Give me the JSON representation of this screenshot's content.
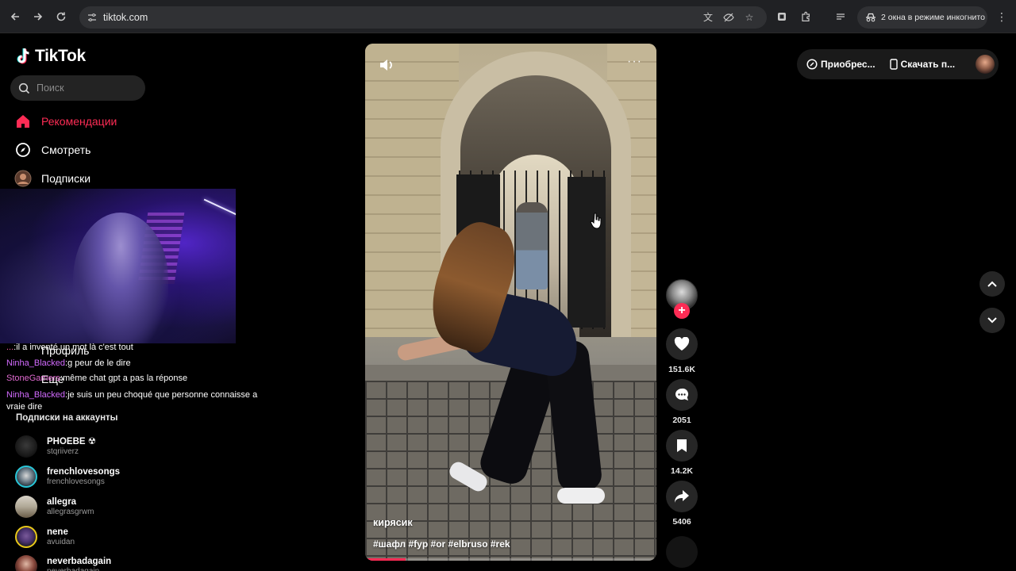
{
  "browser": {
    "url": "tiktok.com",
    "incognito_label": "2 окна в режиме инкогнито"
  },
  "sidebar": {
    "logo": "TikTok",
    "search_placeholder": "Поиск",
    "nav": [
      {
        "label": "Рекомендации",
        "icon": "home-icon",
        "active": true
      },
      {
        "label": "Смотреть",
        "icon": "compass-icon",
        "active": false
      },
      {
        "label": "Подписки",
        "icon": "following-avatar-icon",
        "active": false
      }
    ],
    "ghost_items": [
      "Профиль",
      "Еще"
    ],
    "following_heading": "Подписки на аккаунты",
    "accounts": [
      {
        "name": "PHOEBE ☢",
        "handle": "stqriiverz"
      },
      {
        "name": "frenchlovesongs",
        "handle": "frenchlovesongs"
      },
      {
        "name": "allegra",
        "handle": "allegrasgrwm"
      },
      {
        "name": "nene",
        "handle": "avuidan"
      },
      {
        "name": "neverbadagain",
        "handle": "neverbadagain"
      }
    ]
  },
  "stream_chat": [
    {
      "user": "...",
      "text": "il a inventé un mot là c'est tout"
    },
    {
      "user": "Ninha_Blacked",
      "text": "g peur de le dire"
    },
    {
      "user": "StoneGamers",
      "text": "même chat gpt a pas la réponse"
    },
    {
      "user": "Ninha_Blacked",
      "text": "je suis un peu choqué que personne connaisse a vraie dire"
    }
  ],
  "video": {
    "author": "кирясик",
    "hashtags": "#шафл #fyp #or #elbruso #rek",
    "progress": 0.14
  },
  "actions": {
    "likes": "151.6K",
    "comments": "2051",
    "saves": "14.2K",
    "shares": "5406"
  },
  "topbar": {
    "coins_label": "Приобрес...",
    "download_label": "Скачать п..."
  },
  "colors": {
    "accent": "#fe2c55",
    "background": "#000000"
  }
}
